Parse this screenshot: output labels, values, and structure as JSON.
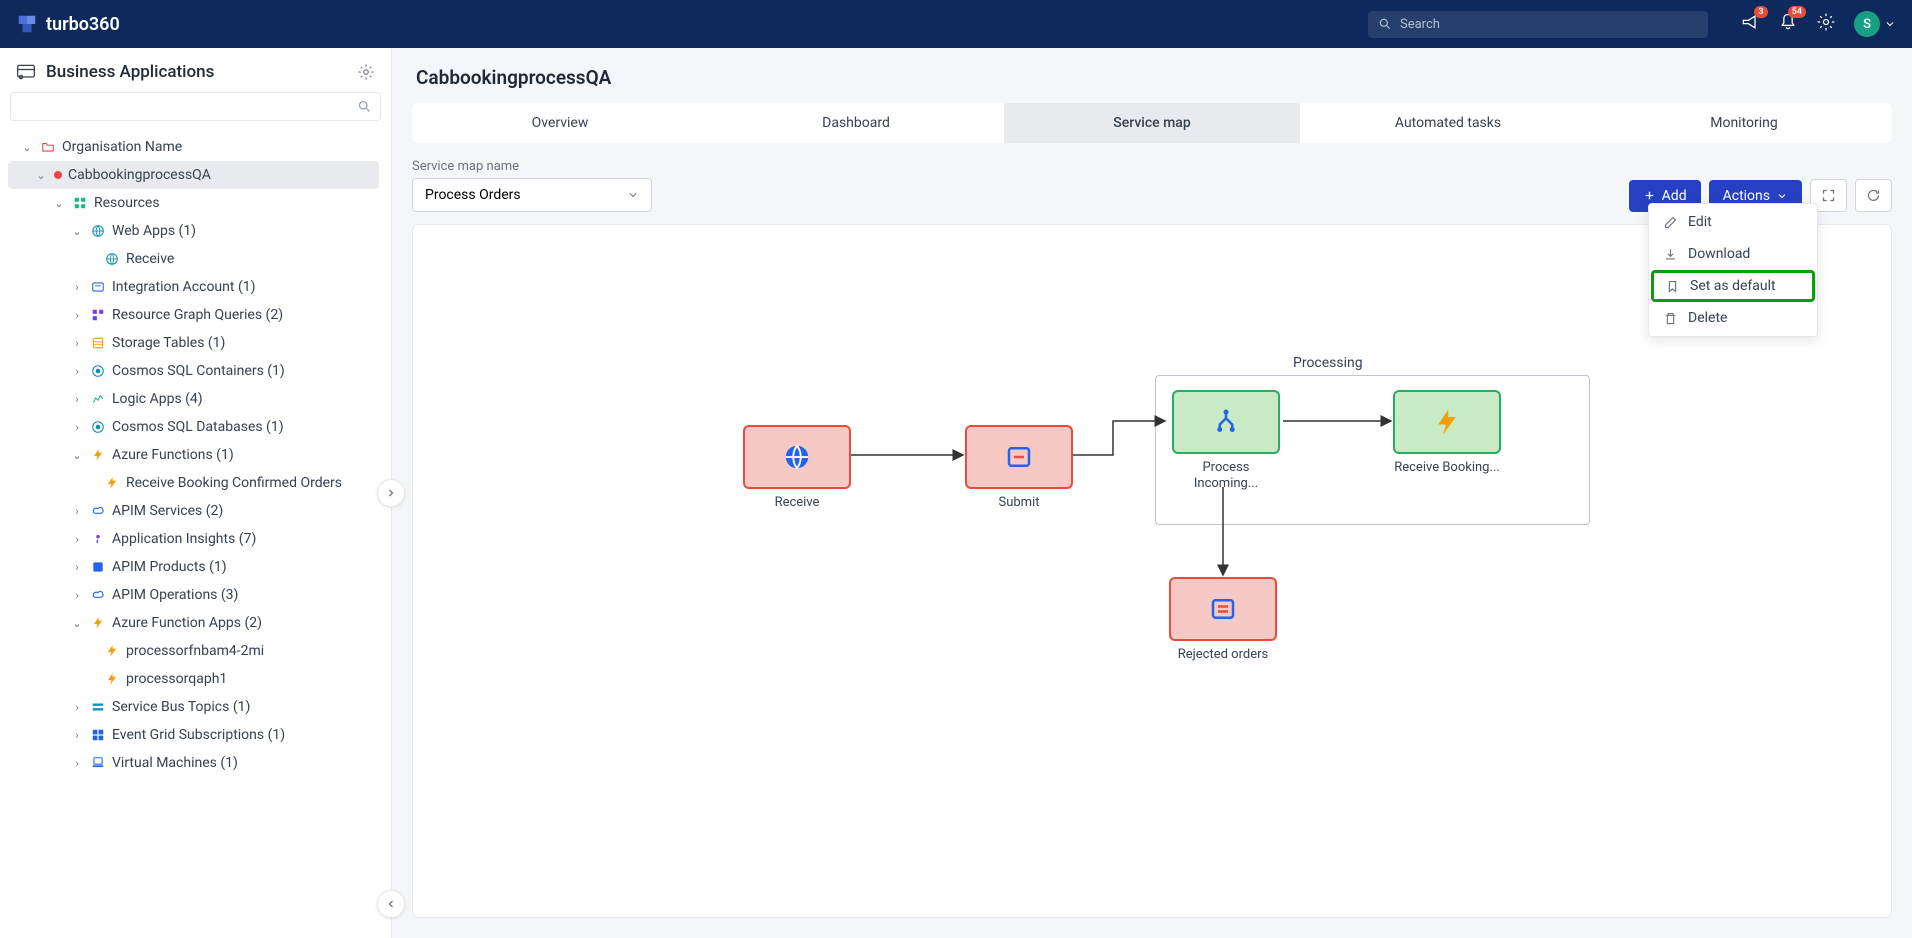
{
  "header": {
    "brand": "turbo360",
    "searchPlaceholder": "Search",
    "notifBadge": "3",
    "bellBadge": "54",
    "avatarInitial": "S"
  },
  "sidebar": {
    "title": "Business Applications",
    "orgLabel": "Organisation Name",
    "selectedApp": "CabbookingprocessQA",
    "resourcesLabel": "Resources",
    "items": {
      "webApps": "Web Apps (1)",
      "receive": "Receive",
      "integrationAccount": "Integration Account (1)",
      "resourceGraphQueries": "Resource Graph Queries (2)",
      "storageTables": "Storage Tables (1)",
      "cosmosSqlContainers": "Cosmos SQL Containers (1)",
      "logicApps": "Logic Apps (4)",
      "cosmosSqlDatabases": "Cosmos SQL Databases (1)",
      "azureFunctions": "Azure Functions (1)",
      "receiveBooking": "Receive Booking Confirmed Orders",
      "apimServices": "APIM Services (2)",
      "appInsights": "Application Insights (7)",
      "apimProducts": "APIM Products (1)",
      "apimOperations": "APIM Operations (3)",
      "azureFunctionApps": "Azure Function Apps (2)",
      "processor1": "processorfnbam4-2mi",
      "processor2": "processorqaph1",
      "serviceBusTopics": "Service Bus Topics (1)",
      "eventGridSubs": "Event Grid Subscriptions (1)",
      "virtualMachines": "Virtual Machines (1)"
    }
  },
  "main": {
    "pageTitle": "CabbookingprocessQA",
    "tabs": [
      "Overview",
      "Dashboard",
      "Service map",
      "Automated tasks",
      "Monitoring"
    ],
    "activeTabIndex": 2,
    "serviceMapLabel": "Service map name",
    "serviceMapValue": "Process Orders",
    "addButton": "Add",
    "actionsButton": "Actions",
    "actionsMenu": {
      "edit": "Edit",
      "download": "Download",
      "setDefault": "Set as default",
      "delete": "Delete"
    },
    "diagram": {
      "groupLabel": "Processing",
      "nodes": {
        "receive": "Receive",
        "submit": "Submit",
        "processIncoming": "Process Incoming...",
        "receiveBooking": "Receive Booking...",
        "rejectedOrders": "Rejected orders"
      }
    }
  }
}
